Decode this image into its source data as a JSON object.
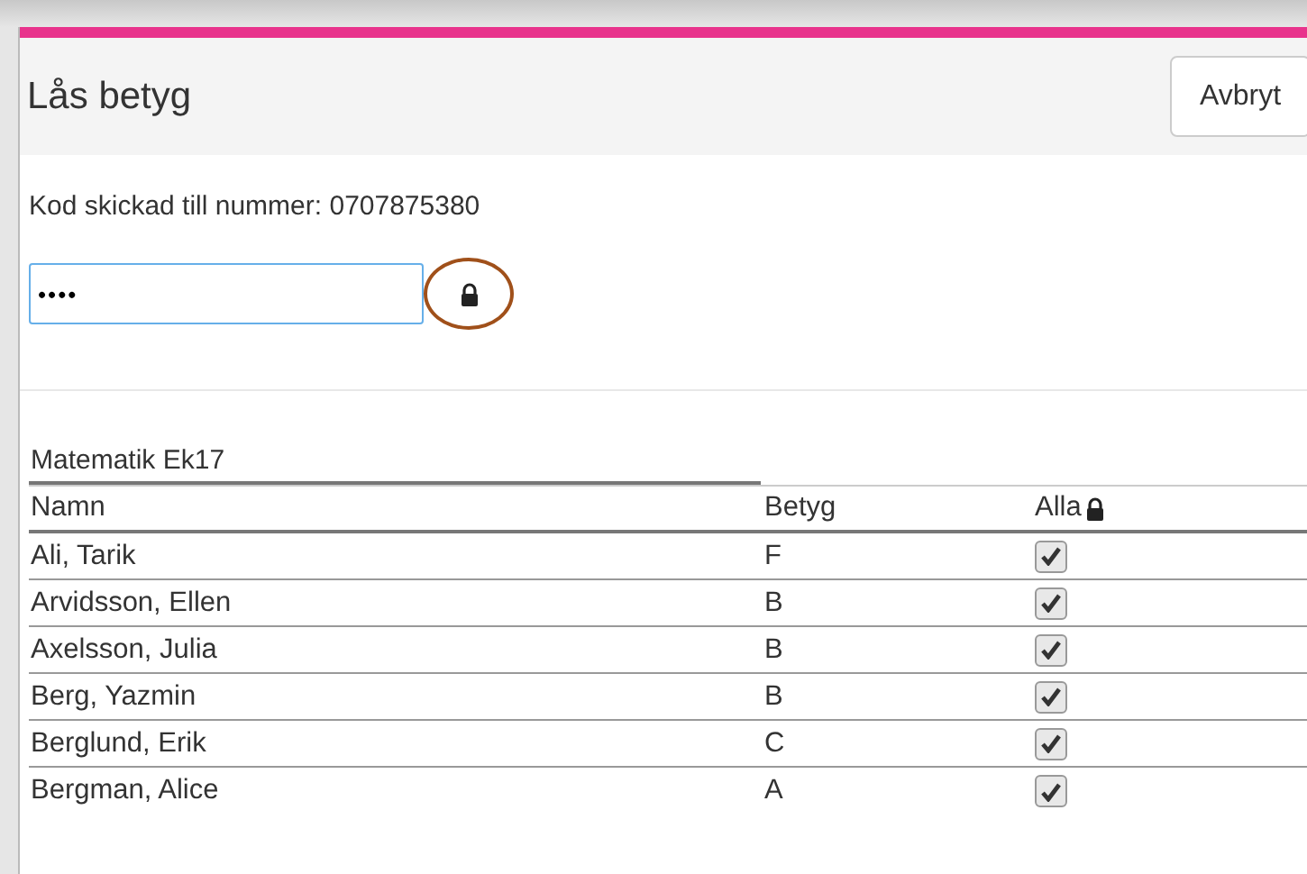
{
  "dialog": {
    "title": "Lås betyg",
    "cancel_button": "Avbryt"
  },
  "code_message": "Kod skickad till nummer: 0707875380",
  "code_field": {
    "value": "••••"
  },
  "lock_button": {
    "highlighted": true
  },
  "table": {
    "caption": "Matematik Ek17",
    "columns": [
      "Namn",
      "Betyg",
      "Alla"
    ],
    "rows": [
      {
        "name": "Ali, Tarik",
        "grade": "F",
        "checked": true
      },
      {
        "name": "Arvidsson, Ellen",
        "grade": "B",
        "checked": true
      },
      {
        "name": "Axelsson, Julia",
        "grade": "B",
        "checked": true
      },
      {
        "name": "Berg, Yazmin",
        "grade": "B",
        "checked": true
      },
      {
        "name": "Berglund, Erik",
        "grade": "C",
        "checked": true
      },
      {
        "name": "Bergman, Alice",
        "grade": "A",
        "checked": true
      }
    ]
  }
}
